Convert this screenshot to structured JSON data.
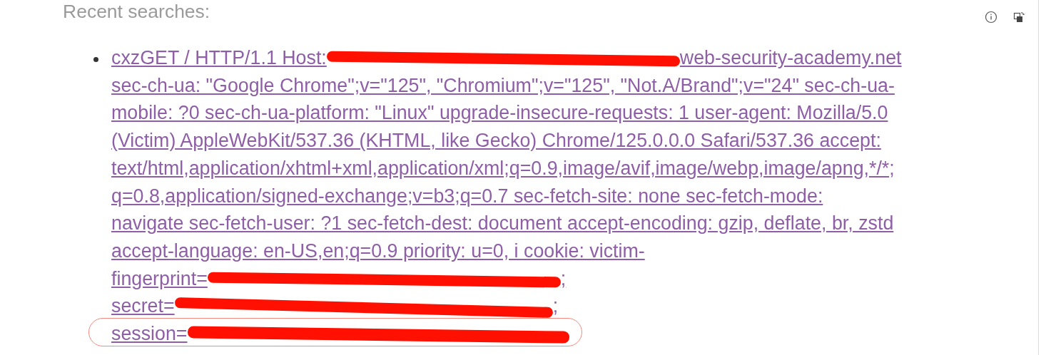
{
  "heading": "Recent searches:",
  "searches": [
    {
      "lines": [
        {
          "text": "cxzGET / HTTP/1.1 Host:",
          "redacted": true,
          "after": "web-security-academy.net"
        },
        {
          "text": "sec-ch-ua: \"Google Chrome\";v=\"125\", \"Chromium\";v=\"125\", \"Not.A/Brand\";v=\"24\" sec-ch-ua-"
        },
        {
          "text": "mobile: ?0 sec-ch-ua-platform: \"Linux\" upgrade-insecure-requests: 1 user-agent: Mozilla/5.0"
        },
        {
          "text": "(Victim) AppleWebKit/537.36 (KHTML, like Gecko) Chrome/125.0.0.0 Safari/537.36 accept:"
        },
        {
          "text": "text/html,application/xhtml+xml,application/xml;q=0.9,image/avif,image/webp,image/apng,*/*;"
        },
        {
          "text": "q=0.8,application/signed-exchange;v=b3;q=0.7 sec-fetch-site: none sec-fetch-mode:"
        },
        {
          "text": "navigate sec-fetch-user: ?1 sec-fetch-dest: document accept-encoding: gzip, deflate, br, zstd"
        },
        {
          "text": "accept-language: en-US,en;q=0.9 priority: u=0, i cookie: victim-"
        },
        {
          "text": "fingerprint=",
          "redacted": true,
          "after": ";"
        },
        {
          "text": "secret=",
          "redacted": true,
          "after": ";"
        },
        {
          "text": "session=",
          "redacted": true,
          "circled": true
        }
      ]
    }
  ]
}
